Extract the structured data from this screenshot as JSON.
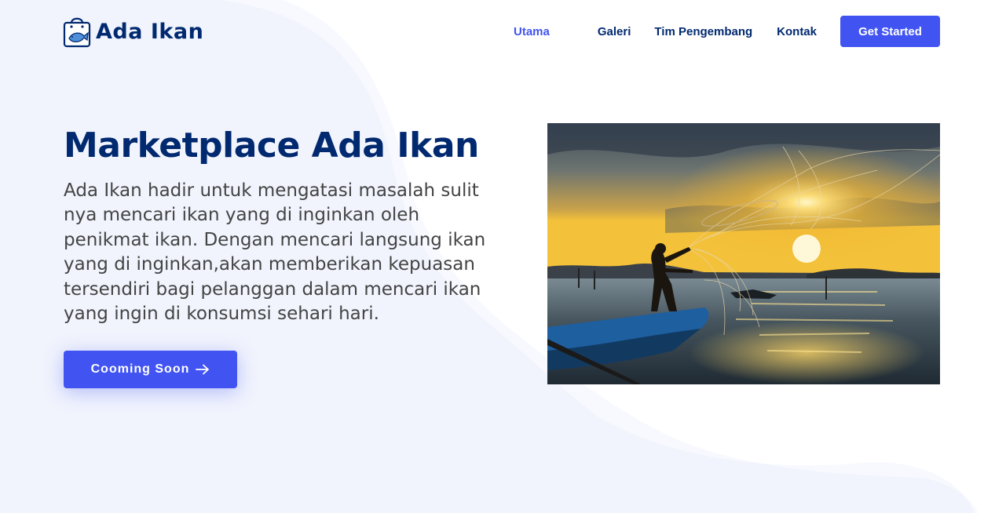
{
  "brand": {
    "name": "Ada Ikan",
    "logo_icon": "shopping-bag-fish-icon"
  },
  "nav": {
    "items": [
      {
        "label": "Utama",
        "active": true
      },
      {
        "label": "Galeri",
        "active": false
      },
      {
        "label": "Tim Pengembang",
        "active": false
      },
      {
        "label": "Kontak",
        "active": false
      }
    ],
    "cta_label": "Get Started"
  },
  "hero": {
    "title": "Marketplace Ada Ikan",
    "description": "Ada Ikan hadir untuk mengatasi masalah sulit nya mencari ikan yang di inginkan oleh penikmat ikan. Dengan mencari langsung ikan yang di inginkan,akan memberikan kepuasan tersendiri bagi pelanggan dalam mencari ikan yang ingin di konsumsi sehari hari.",
    "button_label": "Cooming Soon",
    "button_icon": "arrow-right-icon"
  },
  "colors": {
    "primary": "#4154f1",
    "heading": "#012970",
    "body_text": "#444444",
    "background_wave": "#f1f4fd"
  }
}
